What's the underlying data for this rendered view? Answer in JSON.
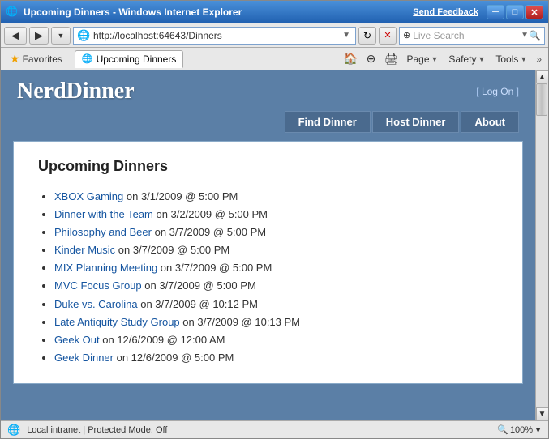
{
  "window": {
    "title": "Upcoming Dinners - Windows Internet Explorer",
    "feedback_label": "Send Feedback",
    "title_icon": "🌐"
  },
  "address_bar": {
    "url": "http://localhost:64643/Dinners",
    "search_placeholder": "Live Search",
    "search_label": "Live Search"
  },
  "toolbar": {
    "favorites_label": "Favorites",
    "tab_label": "Upcoming Dinners",
    "page_btn": "Page",
    "safety_btn": "Safety",
    "tools_btn": "Tools"
  },
  "nav": {
    "find_dinner": "Find Dinner",
    "host_dinner": "Host Dinner",
    "about": "About",
    "log_on": "Log On"
  },
  "page": {
    "site_title": "NerdDinner",
    "section_title": "Upcoming Dinners",
    "login_prefix": "[ ",
    "login_suffix": " ]"
  },
  "dinners": [
    {
      "title": "XBOX Gaming",
      "date": "on 3/1/2009 @ 5:00 PM"
    },
    {
      "title": "Dinner with the Team",
      "date": "on 3/2/2009 @ 5:00 PM"
    },
    {
      "title": "Philosophy and Beer",
      "date": "on 3/7/2009 @ 5:00 PM"
    },
    {
      "title": "Kinder Music",
      "date": "on 3/7/2009 @ 5:00 PM"
    },
    {
      "title": "MIX Planning Meeting",
      "date": "on 3/7/2009 @ 5:00 PM"
    },
    {
      "title": "MVC Focus Group",
      "date": "on 3/7/2009 @ 5:00 PM"
    },
    {
      "title": "Duke vs. Carolina",
      "date": "on 3/7/2009 @ 10:12 PM"
    },
    {
      "title": "Late Antiquity Study Group",
      "date": "on 3/7/2009 @ 10:13 PM"
    },
    {
      "title": "Geek Out",
      "date": "on 12/6/2009 @ 12:00 AM"
    },
    {
      "title": "Geek Dinner",
      "date": "on 12/6/2009 @ 5:00 PM"
    }
  ],
  "status_bar": {
    "status": "Local intranet | Protected Mode: Off",
    "zoom": "100%",
    "zoom_label": "🔍"
  },
  "colors": {
    "accent": "#5b7fa6",
    "nav_bg": "#4a6a8e",
    "link": "#1555a0"
  }
}
